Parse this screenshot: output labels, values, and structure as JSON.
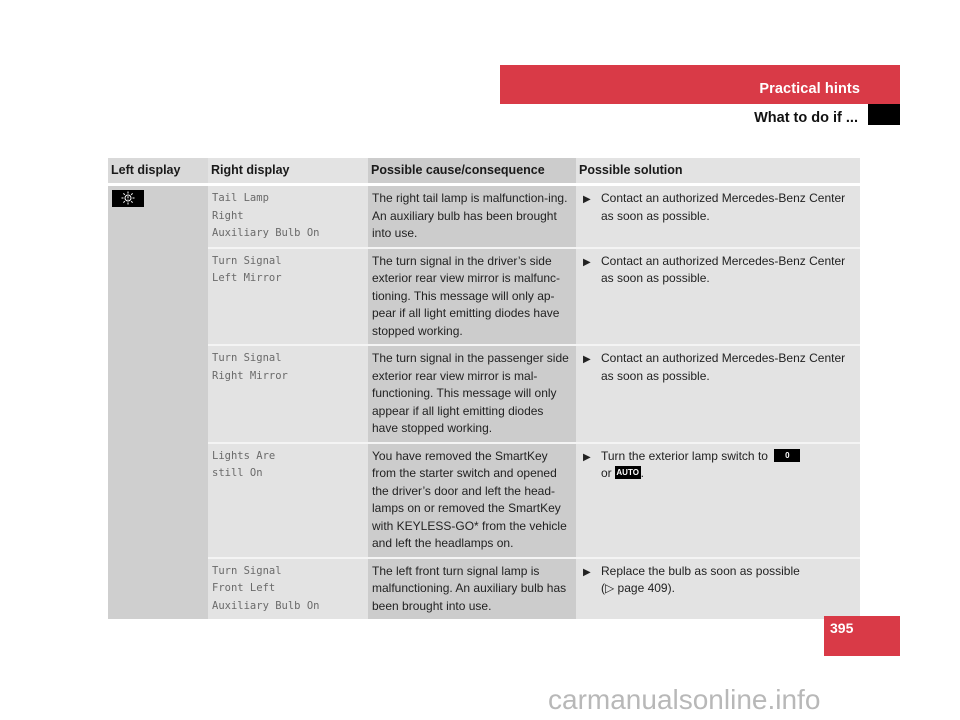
{
  "header": {
    "section_title": "Practical hints",
    "subsection_title": "What to do if ..."
  },
  "colors": {
    "accent_red": "#d93a47",
    "black": "#000000"
  },
  "table": {
    "columns": [
      "Left display",
      "Right display",
      "Possible cause/consequence",
      "Possible solution"
    ],
    "left_display_icon": "exterior-lamp-malfunction-icon",
    "rows": [
      {
        "right_display": [
          "Tail Lamp",
          "Right",
          "Auxiliary Bulb On"
        ],
        "cause": "The right tail lamp is malfunction-ing. An auxiliary bulb has been brought into use.",
        "solution": "Contact an authorized Mercedes-Benz Center as soon as possible."
      },
      {
        "right_display": [
          "Turn Signal",
          "Left Mirror"
        ],
        "cause": "The turn signal in the driver’s side exterior rear view mirror is malfunc-tioning. This message will only ap-pear if all light emitting diodes have stopped working.",
        "solution": "Contact an authorized Mercedes-Benz Center as soon as possible."
      },
      {
        "right_display": [
          "Turn Signal",
          "Right Mirror"
        ],
        "cause": "The turn signal in the passenger side exterior rear view mirror is mal-functioning. This message will only appear if all light emitting diodes have stopped working.",
        "solution": "Contact an authorized Mercedes-Benz Center as soon as possible."
      },
      {
        "right_display": [
          "Lights Are",
          "still On"
        ],
        "cause": "You have removed the SmartKey from the starter switch and opened the driver’s door and left the head-lamps on or removed the SmartKey with KEYLESS-GO* from the vehicle and left the headlamps on.",
        "solution_prefix": "Turn the exterior lamp switch to",
        "solution_badge_1": "0",
        "solution_or": "or",
        "solution_badge_2": "AUTO",
        "solution_suffix": "."
      },
      {
        "right_display": [
          "Turn Signal",
          "Front Left",
          "Auxiliary Bulb On"
        ],
        "cause": "The left front turn signal lamp is malfunctioning. An auxiliary bulb has been brought into use.",
        "solution_line1": "Replace the bulb as soon as possible",
        "solution_line2": "(▷ page 409)."
      }
    ]
  },
  "footer": {
    "page_number": "395",
    "watermark": "carmanualsonline.info"
  }
}
